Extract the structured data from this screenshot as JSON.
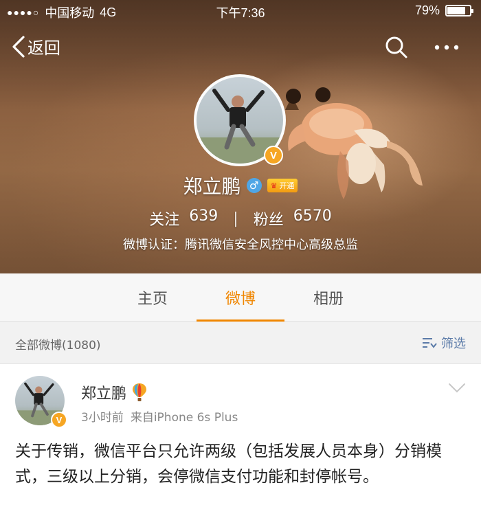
{
  "status_bar": {
    "signal": "●●●●○",
    "carrier": "中国移动",
    "network": "4G",
    "time": "下午7:36",
    "battery": "79%",
    "battery_level": 0.79
  },
  "nav": {
    "back_label": "返回",
    "icons": [
      "chevron-left-icon",
      "search-icon",
      "more-icon"
    ]
  },
  "profile": {
    "name": "郑立鹏",
    "verified_badge": "V",
    "gender_symbol": "♂",
    "member_badge": "开通",
    "following_label": "关注",
    "following_count": "639",
    "separator": "|",
    "followers_label": "粉丝",
    "followers_count": "6570",
    "verification": "微博认证：腾讯微信安全风控中心高级总监"
  },
  "tabs": [
    {
      "label": "主页",
      "active": false
    },
    {
      "label": "微博",
      "active": true
    },
    {
      "label": "相册",
      "active": false
    }
  ],
  "filter": {
    "all_posts": "全部微博(1080)",
    "filter_label": "筛选"
  },
  "post": {
    "author": "郑立鹏",
    "time": "3小时前",
    "source": "来自iPhone 6s Plus",
    "verified_badge": "V",
    "text": "关于传销，微信平台只允许两级（包括发展人员本身）分销模式，三级以上分销，会停微信支付功能和封停帐号。"
  },
  "colors": {
    "accent": "#f08600",
    "verified": "#f6a623",
    "link": "#5a7aa8",
    "gender": "#4fa6e6"
  }
}
